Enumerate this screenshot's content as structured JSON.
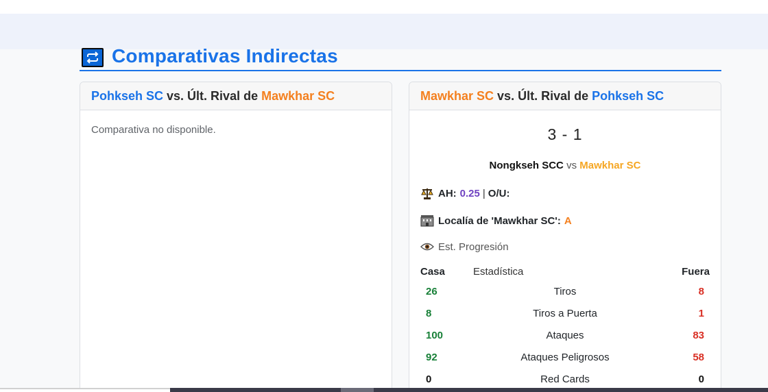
{
  "section": {
    "title": "Comparativas Indirectas",
    "icon": "repeat-icon"
  },
  "left_card": {
    "team_a": "Pohkseh SC",
    "middle": " vs. Últ. Rival de ",
    "team_b": "Mawkhar SC",
    "message": "Comparativa no disponible."
  },
  "right_card": {
    "team_a": "Mawkhar SC",
    "middle": " vs. Últ. Rival de ",
    "team_b": "Pohkseh SC",
    "score": "3 - 1",
    "match": {
      "home": "Nongkseh SCC",
      "vs": "vs",
      "away": "Mawkhar SC"
    },
    "ah": {
      "icon": "scales-icon",
      "label": "AH:",
      "value": "0.25",
      "separator": "|",
      "ou_label": "O/U:"
    },
    "locality": {
      "icon": "stadium-icon",
      "label": "Localía de 'Mawkhar SC':",
      "value": "A"
    },
    "progression": {
      "icon": "eye-icon",
      "label": "Est. Progresión"
    },
    "stats_header": {
      "home": "Casa",
      "stat": "Estadística",
      "away": "Fuera"
    },
    "stats": [
      {
        "home": "26",
        "label": "Tiros",
        "away": "8"
      },
      {
        "home": "8",
        "label": "Tiros a Puerta",
        "away": "1"
      },
      {
        "home": "100",
        "label": "Ataques",
        "away": "83"
      },
      {
        "home": "92",
        "label": "Ataques Peligrosos",
        "away": "58"
      },
      {
        "home": "0",
        "label": "Red Cards",
        "away": "0"
      }
    ]
  },
  "colors": {
    "accent_blue": "#1a73e8",
    "accent_orange": "#f4801f",
    "stat_home": "#188038",
    "stat_away": "#d93025",
    "ah_value": "#6f42c1"
  }
}
